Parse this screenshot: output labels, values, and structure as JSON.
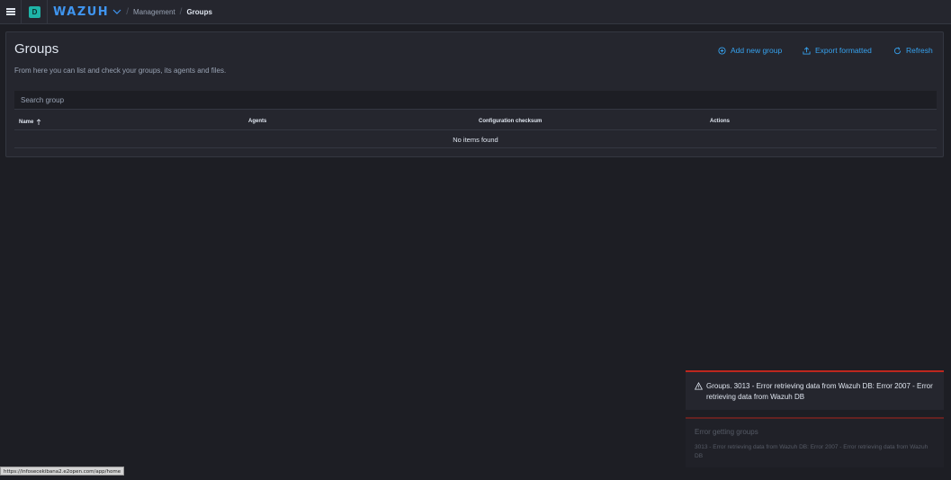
{
  "header": {
    "space_initial": "D",
    "logo_text": "WAZUH",
    "breadcrumbs": [
      {
        "label": "Management"
      },
      {
        "label": "Groups"
      }
    ]
  },
  "groups": {
    "title": "Groups",
    "description": "From here you can list and check your groups, its agents and files.",
    "actions": {
      "add_new": "Add new group",
      "export": "Export formatted",
      "refresh": "Refresh"
    },
    "search": {
      "placeholder": "Search group",
      "value": ""
    },
    "table": {
      "columns": [
        {
          "label": "Name",
          "sorted": "ascending"
        },
        {
          "label": "Agents"
        },
        {
          "label": "Configuration checksum"
        },
        {
          "label": "Actions"
        }
      ],
      "empty_message": "No items found"
    }
  },
  "toasts": [
    {
      "title": "Groups. 3013 - Error retrieving data from Wazuh DB: Error 2007 - Error retrieving data from Wazuh DB",
      "icon": "alert-icon"
    },
    {
      "title": "Error getting groups",
      "body": "3013 - Error retrieving data from Wazuh DB: Error 2007 - Error retrieving data from Wazuh DB"
    }
  ],
  "status_url": "https://infosecekibana2.e2open.com/app/home",
  "colors": {
    "accent": "#36a2ef",
    "logo": "#3f95f0",
    "danger": "#bd271e",
    "space_avatar": "#1eb4a8",
    "background": "#1d1e24",
    "panel": "#25262e"
  }
}
